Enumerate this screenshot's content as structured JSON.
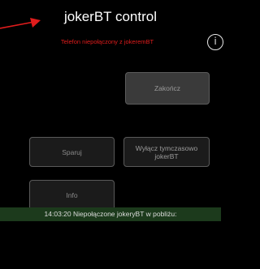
{
  "header": {
    "title": "jokerBT control",
    "connection_status": "Telefon niepołączony z jokeremBT"
  },
  "icons": {
    "info": "info-icon",
    "arrow": "red-arrow-icon"
  },
  "colors": {
    "background": "#000000",
    "connection_status_text": "#e01c1c",
    "arrow": "#e01c1c",
    "status_bar_background": "#1c3a1c"
  },
  "buttons": {
    "end": "Zakończ",
    "pair": "Sparuj",
    "disable_temporarily": "Wyłącz tymczasowo jokerBT",
    "info": "Info"
  },
  "status_bar": {
    "time": "14:03:20",
    "message": "Niepołączone jokeryBT w pobliżu:"
  }
}
